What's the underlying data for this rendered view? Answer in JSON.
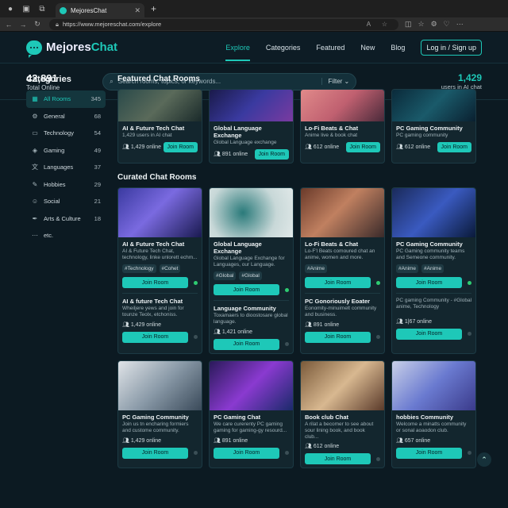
{
  "browser": {
    "tab_title": "MejoresChat",
    "url": "https://www.mejoreschat.com/explore"
  },
  "header": {
    "logo_a": "Mejores",
    "logo_b": "Chat",
    "nav": [
      "Explore",
      "Categories",
      "Featured",
      "New",
      "Blog"
    ],
    "login": "Log in / Sign up"
  },
  "stats": {
    "total": "42,891",
    "total_label": "Total Online",
    "ai": "1,429",
    "ai_label": "users in AI chat"
  },
  "search": {
    "placeholder": "Search rooms, topics, or keywords...",
    "filter": "Filter"
  },
  "sidebar": {
    "title": "Categories",
    "items": [
      {
        "label": "All Rooms",
        "count": "345"
      },
      {
        "label": "General",
        "count": "68"
      },
      {
        "label": "Technology",
        "count": "54"
      },
      {
        "label": "Gaming",
        "count": "49"
      },
      {
        "label": "Languages",
        "count": "37"
      },
      {
        "label": "Hobbies",
        "count": "29"
      },
      {
        "label": "Social",
        "count": "21"
      },
      {
        "label": "Arts & Culture",
        "count": "18"
      },
      {
        "label": "etc.",
        "count": ""
      }
    ]
  },
  "featured": {
    "title": "Featured Chat Rooms",
    "cards": [
      {
        "title": "AI & Future Tech Chat",
        "sub": "1,429 users in AI chat",
        "online": "1,429 online",
        "btn": "Join Room"
      },
      {
        "title": "Global Language Exchange",
        "sub": "Global Language exchange",
        "online": "891 online",
        "btn": "Join Room"
      },
      {
        "title": "Lo-Fi Beats & Chat",
        "sub": "Anime live & book chat",
        "online": "612 online",
        "btn": "Join Room"
      },
      {
        "title": "PC Gaming Community",
        "sub": "PC gaming community",
        "online": "612 online",
        "btn": "Join Room"
      }
    ]
  },
  "curated": {
    "title": "Curated Chat Rooms",
    "cards": [
      {
        "title": "AI & Future Tech Chat",
        "sub": "AI & Future Tech Chat, technology, linke unlorett echm...",
        "tags": [
          "#Technology",
          "#Cohet"
        ],
        "btn": "Join Room",
        "title2": "AI & future Tech Chat",
        "sub2": "Wheiljere yews and join for tounze Teolx, etchoniss.",
        "online": "1,429 online",
        "btn2": "Join Room"
      },
      {
        "title": "Global Language Exchange",
        "sub": "Global Language Exchange for Languages, our Language.",
        "tags": [
          "#Global",
          "#Global"
        ],
        "btn": "Join Room",
        "title2": "Language Community",
        "sub2": "Toxamaers to dioostosare global language.",
        "online": "1,421 online",
        "btn2": "Join Room"
      },
      {
        "title": "Lo-Fi Beats & Chat",
        "sub": "Lo-F'l Beats comoured chat an anime, women and more.",
        "tags": [
          "#Anime"
        ],
        "btn": "Join Room",
        "title2": "PC Gonoriously Eoater",
        "sub2": "Eonomity-minuimelt community and business.",
        "online": "891 online",
        "btn2": "Join Room"
      },
      {
        "title": "PC Gaming Community",
        "sub": "PC Gaming community teams and Semeone community.",
        "tags": [
          "#Anime",
          "#Anime"
        ],
        "btn": "Join Room",
        "title2": "",
        "sub2": "PC gaming Community - #Global anime, Technology",
        "online": "1|67 online",
        "btn2": "Join Room"
      }
    ]
  },
  "third_row": [
    {
      "title": "PC Gaming Community",
      "sub": "Join us tn encharing formiers and custome community.",
      "online": "1,429 online",
      "btn": "Join Room"
    },
    {
      "title": "PC Gaming Chat",
      "sub": "We care curerenty PC gaming gaming for gaming-gy resourd...",
      "online": "891 online",
      "btn": "Join Room"
    },
    {
      "title": "Book club Chat",
      "sub": "A rilat a becomer to see about sour lining book, and book club...",
      "online": "612 online",
      "btn": "Join Room"
    },
    {
      "title": "hobbies Community",
      "sub": "Welcome a minatts community or sonal aoaodon club.",
      "online": "657 online",
      "btn": "Join Room"
    }
  ]
}
